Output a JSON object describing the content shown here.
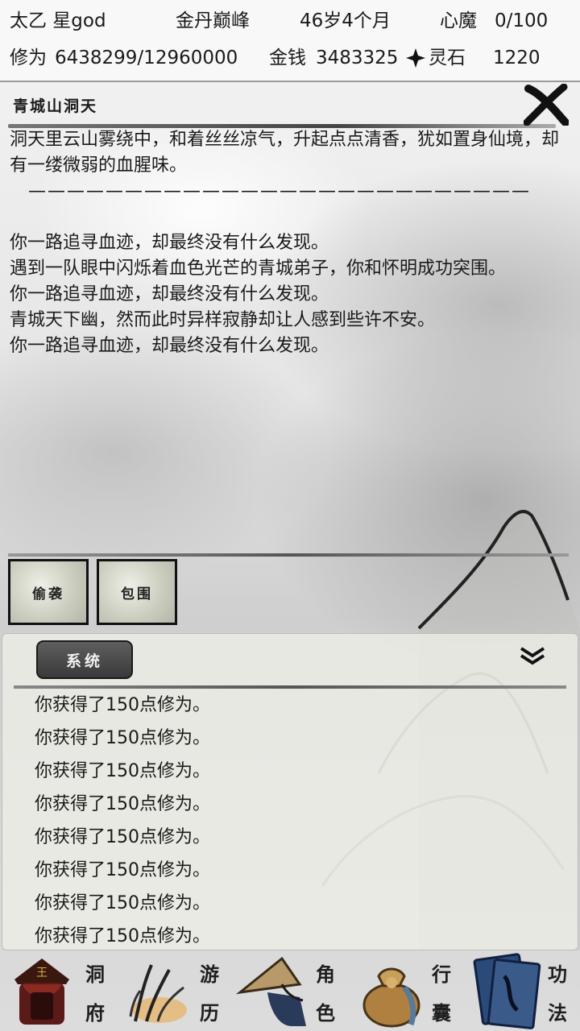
{
  "status": {
    "name": "太乙 星god",
    "realm": "金丹巅峰",
    "age": "46岁4个月",
    "demon_label": "心魔",
    "demon_value": "0/100",
    "cultivation_label": "修为",
    "cultivation_value": "6438299/12960000",
    "money_label": "金钱",
    "money_value": "3483325",
    "spirit_label": "灵石",
    "spirit_value": "1220"
  },
  "location": {
    "title": "青城山洞天",
    "close_icon": "close-x-icon"
  },
  "story": {
    "intro": "洞天里云山雾绕中，和着丝丝凉气，升起点点清香，犹如置身仙境，却有一缕微弱的血腥味。",
    "separator": "——————————————————————————",
    "events": [
      "你一路追寻血迹，却最终没有什么发现。",
      "遇到一队眼中闪烁着血色光芒的青城弟子，你和怀明成功突围。",
      "你一路追寻血迹，却最终没有什么发现。",
      "青城天下幽，然而此时异样寂静却让人感到些许不安。",
      "你一路追寻血迹，却最终没有什么发现。"
    ]
  },
  "actions": [
    {
      "label": "偷袭"
    },
    {
      "label": "包围"
    }
  ],
  "log": {
    "tab_label": "系统",
    "entries": [
      "你获得了150点修为。",
      "你获得了150点修为。",
      "你获得了150点修为。",
      "你获得了150点修为。",
      "你获得了150点修为。",
      "你获得了150点修为。",
      "你获得了150点修为。",
      "你获得了150点修为。"
    ]
  },
  "nav": [
    {
      "top": "洞",
      "bottom": "府",
      "icon": "cave-dwelling-icon"
    },
    {
      "top": "游",
      "bottom": "历",
      "icon": "travel-grass-icon"
    },
    {
      "top": "角",
      "bottom": "色",
      "icon": "character-hat-icon"
    },
    {
      "top": "行",
      "bottom": "囊",
      "icon": "bag-icon"
    },
    {
      "top": "功",
      "bottom": "法",
      "icon": "books-icon"
    }
  ],
  "colors": {
    "accent_dark": "#3a3a3a",
    "highlight_glow": "#e8b060",
    "ink": "#1a1a1a"
  }
}
